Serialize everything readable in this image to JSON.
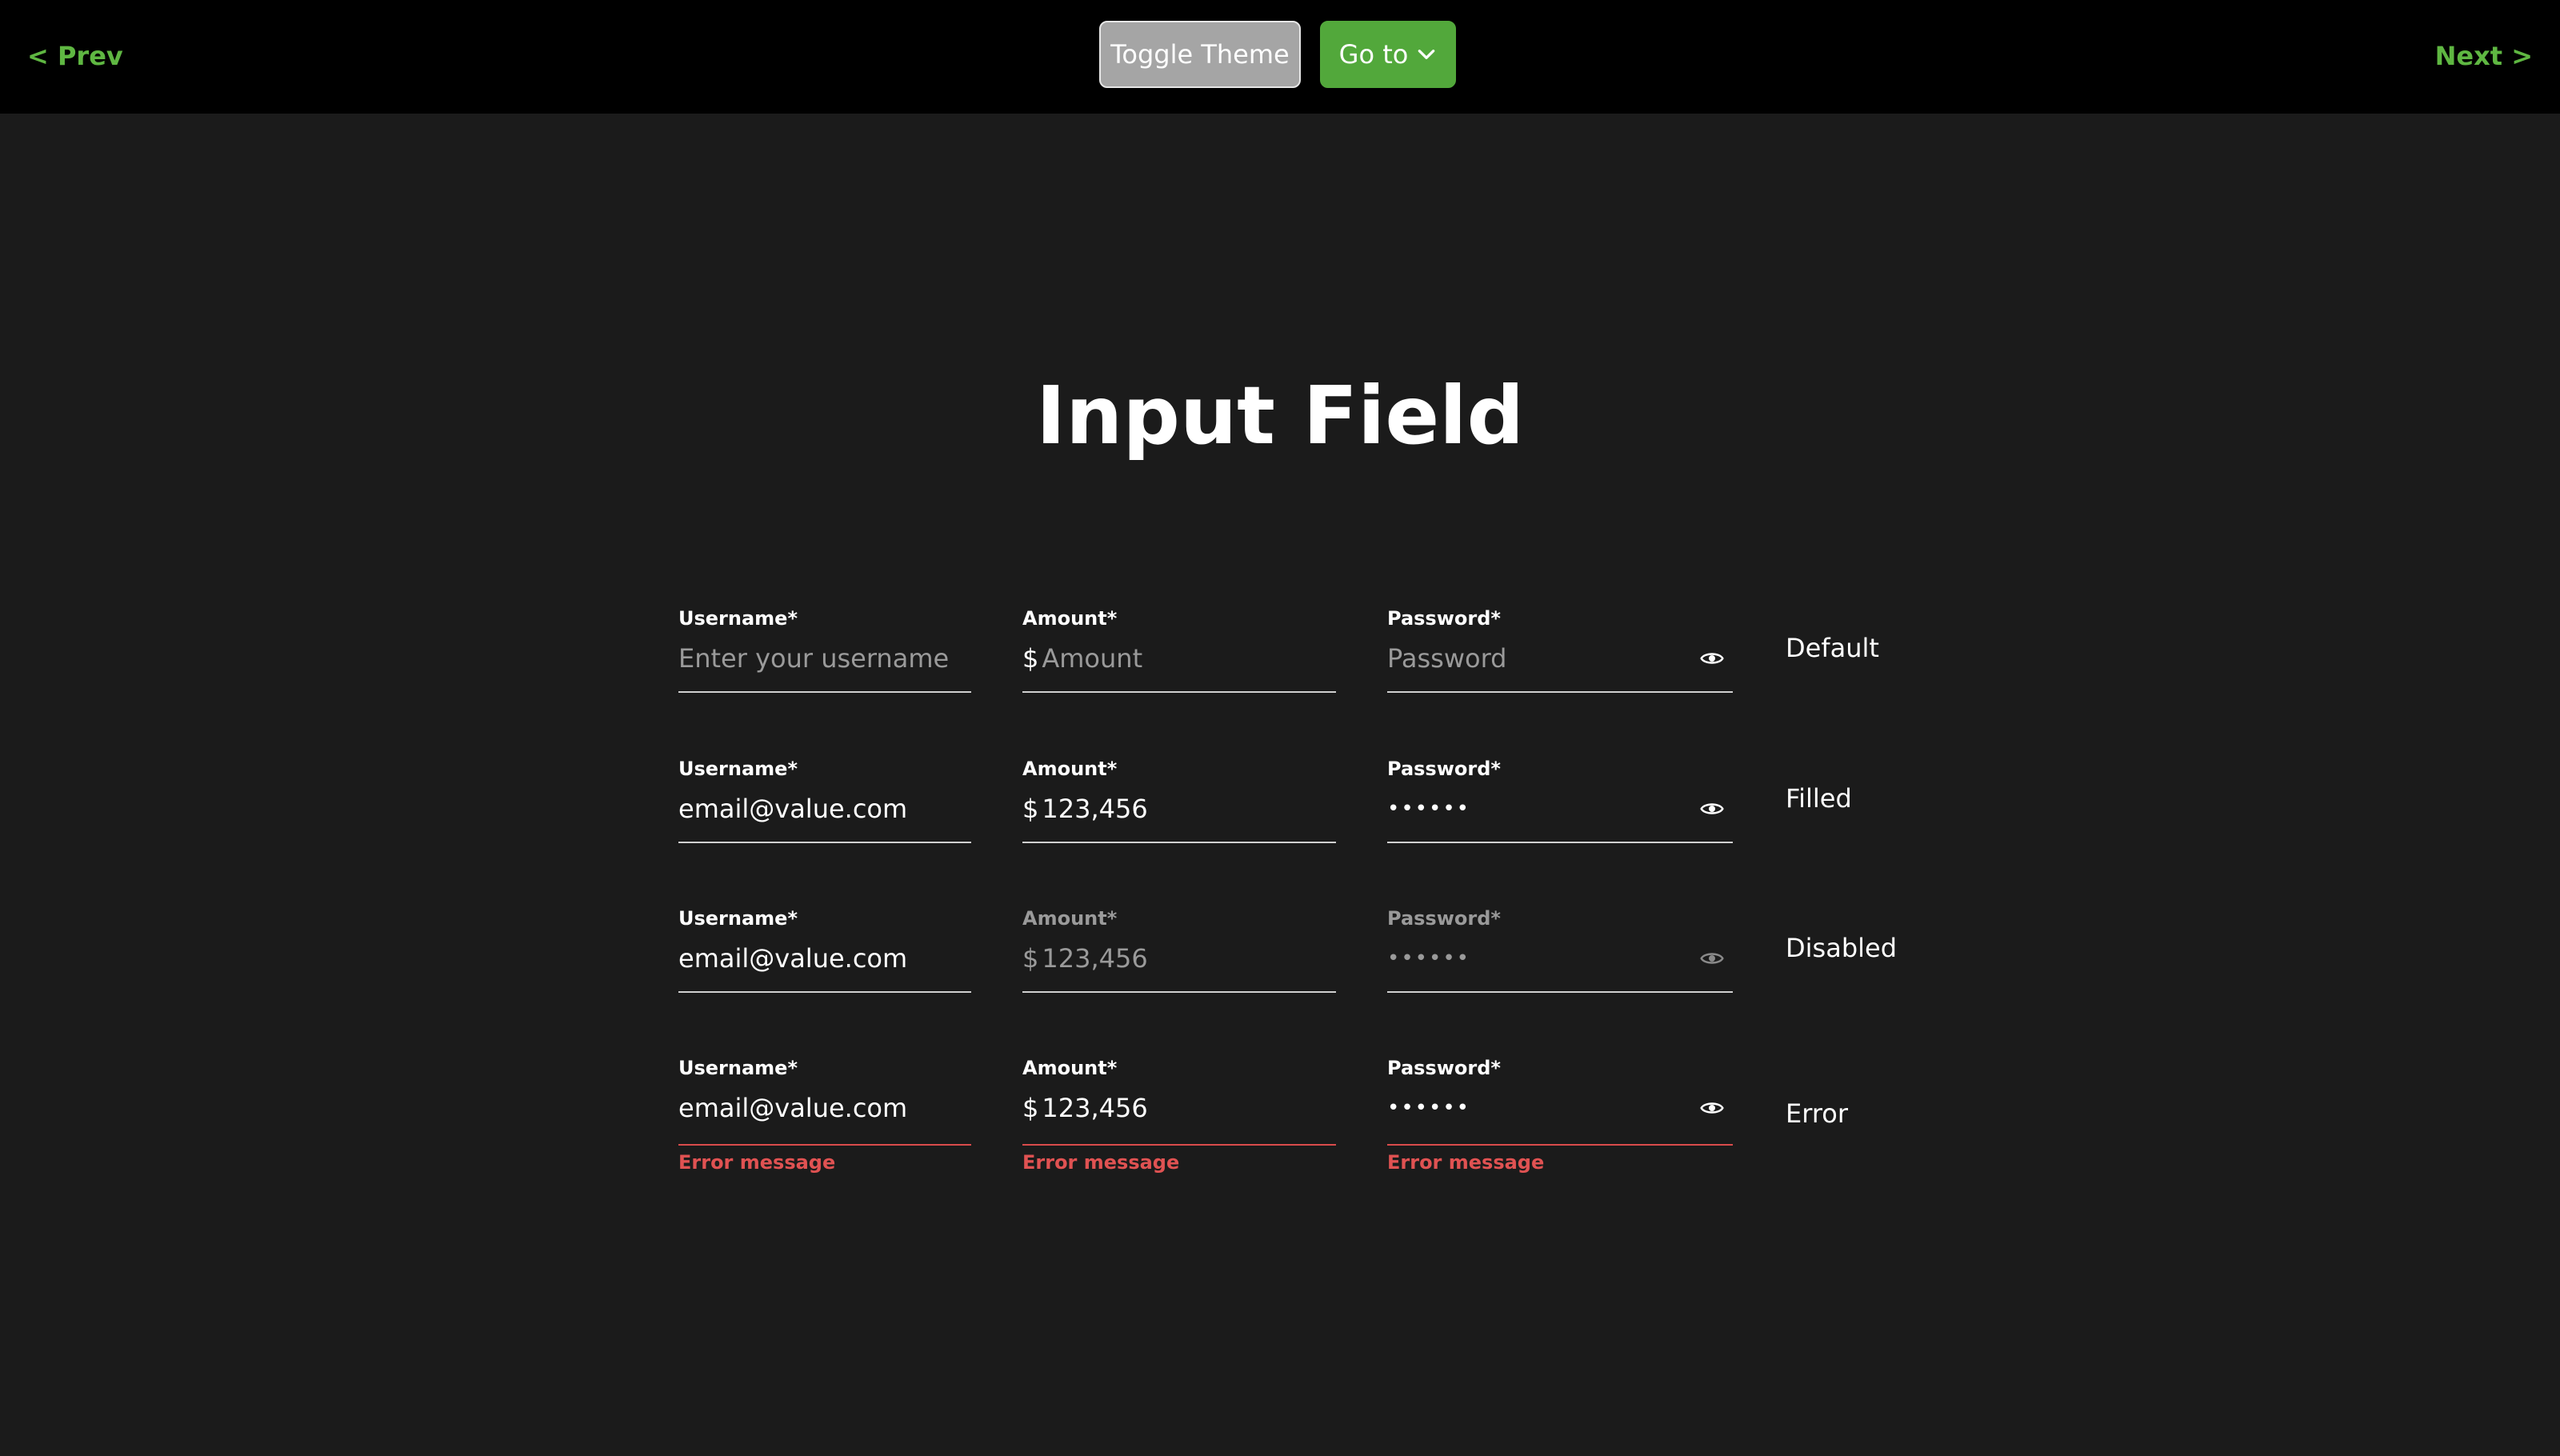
{
  "topbar": {
    "prev_label": "< Prev",
    "next_label": "Next >",
    "toggle_theme_label": "Toggle Theme",
    "goto_label": "Go to",
    "accent_color": "#5fb742"
  },
  "page": {
    "title": "Input Field"
  },
  "rows": [
    {
      "state": "Default",
      "username": {
        "label": "Username*",
        "placeholder": "Enter your username"
      },
      "amount": {
        "label": "Amount*",
        "prefix": "$",
        "placeholder": "Amount"
      },
      "password": {
        "label": "Password*",
        "placeholder": "Password",
        "icon": "eye-icon"
      }
    },
    {
      "state": "Filled",
      "username": {
        "label": "Username*",
        "value": "email@value.com"
      },
      "amount": {
        "label": "Amount*",
        "prefix": "$",
        "value": "123,456"
      },
      "password": {
        "label": "Password*",
        "value": "••••••",
        "icon": "eye-icon"
      }
    },
    {
      "state": "Disabled",
      "username": {
        "label": "Username*",
        "value": "email@value.com"
      },
      "amount": {
        "label": "Amount*",
        "prefix": "$",
        "value": "123,456"
      },
      "password": {
        "label": "Password*",
        "value": "••••••",
        "icon": "eye-icon"
      }
    },
    {
      "state": "Error",
      "username": {
        "label": "Username*",
        "value": "email@value.com",
        "error": "Error message"
      },
      "amount": {
        "label": "Amount*",
        "prefix": "$",
        "value": "123,456",
        "error": "Error message"
      },
      "password": {
        "label": "Password*",
        "value": "••••••",
        "icon": "eye-icon",
        "error": "Error message"
      }
    }
  ],
  "colors": {
    "background": "#1b1b1b",
    "topbar": "#000000",
    "error": "#e05252",
    "goto_button": "#52a83b",
    "toggle_button": "#a5a5a5"
  }
}
